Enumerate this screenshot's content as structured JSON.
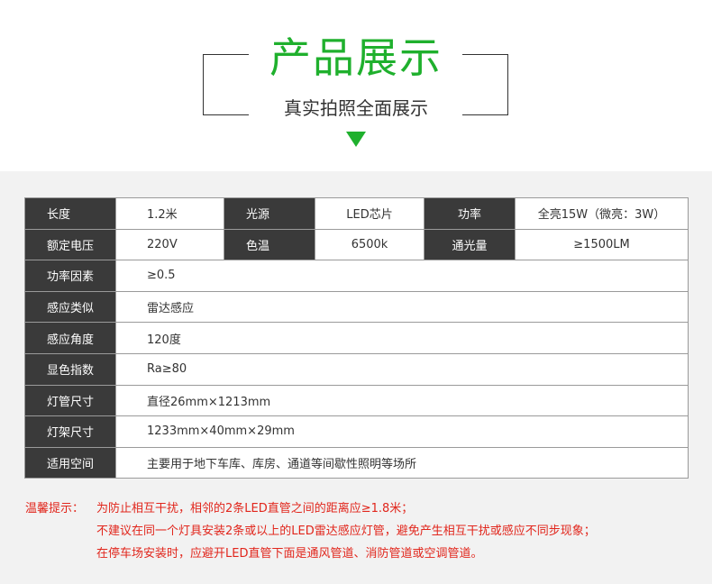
{
  "header": {
    "title": "产品展示",
    "subtitle": "真实拍照全面展示"
  },
  "specs": {
    "row1": [
      {
        "label": "长度",
        "value": "1.2米"
      },
      {
        "label": "光源",
        "value": "LED芯片"
      },
      {
        "label": "功率",
        "value": "全亮15W（微亮：3W）"
      }
    ],
    "row2": [
      {
        "label": "额定电压",
        "value": "220V"
      },
      {
        "label": "色温",
        "value": "6500k"
      },
      {
        "label": "通光量",
        "value": "≥1500LM"
      }
    ],
    "rows": [
      {
        "label": "功率因素",
        "value": "≥0.5"
      },
      {
        "label": "感应类似",
        "value": "雷达感应"
      },
      {
        "label": "感应角度",
        "value": "120度"
      },
      {
        "label": "显色指数",
        "value": "Ra≥80"
      },
      {
        "label": "灯管尺寸",
        "value": "直径26mm×1213mm"
      },
      {
        "label": "灯架尺寸",
        "value": "1233mm×40mm×29mm"
      },
      {
        "label": "适用空间",
        "value": "主要用于地下车库、库房、通道等间歇性照明等场所"
      }
    ]
  },
  "note": {
    "prefix": "温馨提示：",
    "lines": [
      "为防止相互干扰，相邻的2条LED直管之间的距离应≥1.8米；",
      "不建议在同一个灯具安装2条或以上的LED雷达感应灯管，避免产生相互干扰或感应不同步现象；",
      "在停车场安装时，应避开LED直管下面是通风管道、消防管道或空调管道。"
    ]
  },
  "colors": {
    "accent": "#1fb02d",
    "label_bg": "#3a3a3a",
    "warning": "#e1261c"
  }
}
